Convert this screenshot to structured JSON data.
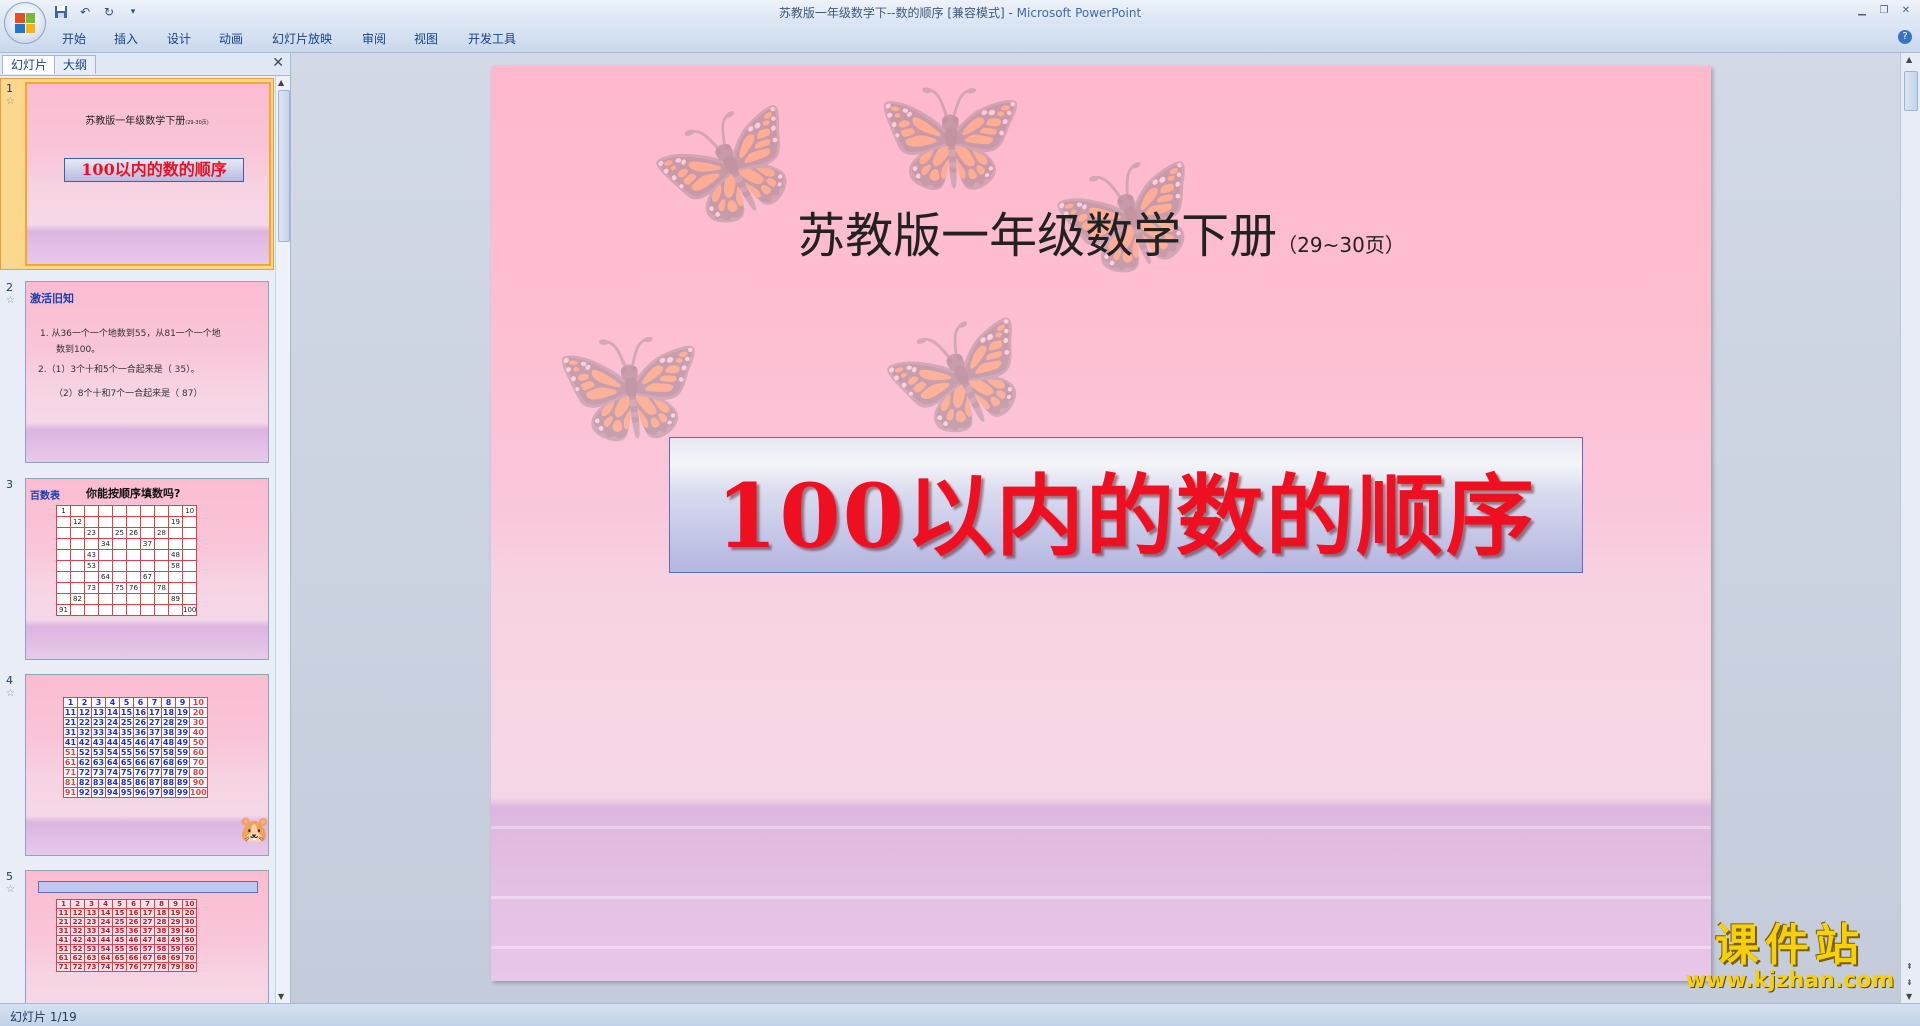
{
  "window": {
    "title_doc": "苏教版一年级数学下--数的顺序 [兼容模式] - ",
    "title_app": "Microsoft PowerPoint"
  },
  "ribbon": {
    "tabs": [
      "开始",
      "插入",
      "设计",
      "动画",
      "幻灯片放映",
      "审阅",
      "视图",
      "开发工具"
    ]
  },
  "pane": {
    "tab_slides": "幻灯片",
    "tab_outline": "大纲",
    "close": "✕"
  },
  "thumbnails": [
    {
      "num": "1",
      "title": "苏教版一年级数学下册",
      "small": "(29-30页)",
      "box": "100以内的数的顺序"
    },
    {
      "num": "2",
      "head": "激活旧知",
      "lines": [
        "1. 从36一个一个地数到55，从81一个一个地",
        "数到100。",
        "2.（1）3个十和5个一合起来是（   35）。",
        "（2）8个十和7个一合起来是（   87）"
      ]
    },
    {
      "num": "3",
      "head": "百数表",
      "subtitle": "你能按顺序填数吗?",
      "cells": [
        "1",
        "",
        "",
        "",
        "",
        "",
        "",
        "",
        "",
        "10",
        "",
        "12",
        "",
        "",
        "",
        "",
        "",
        "",
        "19",
        "",
        "",
        "",
        "23",
        "",
        "25",
        "26",
        "",
        "28",
        "",
        "",
        "",
        "",
        "",
        "34",
        "",
        "",
        "37",
        "",
        "",
        "",
        "",
        "",
        "43",
        "",
        "",
        "",
        "",
        "",
        "48",
        "",
        "",
        "",
        "53",
        "",
        "",
        "",
        "",
        "",
        "58",
        "",
        "",
        "",
        "",
        "64",
        "",
        "",
        "67",
        "",
        "",
        "",
        "",
        "",
        "73",
        "",
        "75",
        "76",
        "",
        "78",
        "",
        "",
        "",
        "82",
        "",
        "",
        "",
        "",
        "",
        "",
        "89",
        "",
        "91",
        "",
        "",
        "",
        "",
        "",
        "",
        "",
        "",
        "100"
      ]
    },
    {
      "num": "4"
    },
    {
      "num": "5"
    }
  ],
  "slide": {
    "title": "苏教版一年级数学下册",
    "pages": "（29~30页）",
    "main_title": "100以内的数的顺序"
  },
  "status": {
    "slide_info": "幻灯片 1/19"
  },
  "watermark": {
    "big": "课件站",
    "url": "www.kjzhan.com"
  }
}
